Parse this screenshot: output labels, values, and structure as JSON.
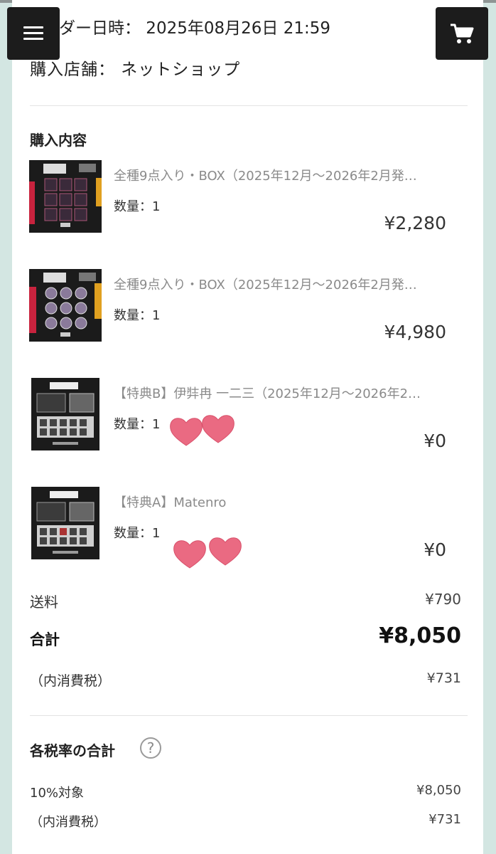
{
  "header": {
    "order_datetime": "ーダー日時： 2025年08月26日 21:59",
    "store": "購入店舗： ネットショップ"
  },
  "purchase": {
    "title": "購入内容",
    "items": [
      {
        "name": "全種9点入り・BOX（2025年12月～2026年2月発…",
        "qty": "数量：1",
        "price": "¥2,280"
      },
      {
        "name": "全種9点入り・BOX（2025年12月～2026年2月発…",
        "qty": "数量：1",
        "price": "¥4,980"
      },
      {
        "name": "【特典B】伊弉冉 一二三（2025年12月～2026年2…",
        "qty": "数量：1",
        "price": "¥0"
      },
      {
        "name": "【特典A】Matenro",
        "qty": "数量：1",
        "price": "¥0"
      }
    ]
  },
  "summary": {
    "shipping_label": "送料",
    "shipping_value": "¥790",
    "total_label": "合計",
    "total_value": "¥8,050",
    "tax_label": "（内消費税）",
    "tax_value": "¥731"
  },
  "tax_rates": {
    "title": "各税率の合計",
    "help_glyph": "?",
    "rate_label": "10%対象",
    "rate_value": "¥8,050",
    "tax_label": "（内消費税）",
    "tax_value": "¥731"
  },
  "colors": {
    "background": "#d3e6e2",
    "button": "#1c1c1c",
    "heart": "#ea6a82"
  },
  "icons": [
    "hamburger-icon",
    "cart-icon",
    "help-icon",
    "heart-icon"
  ]
}
